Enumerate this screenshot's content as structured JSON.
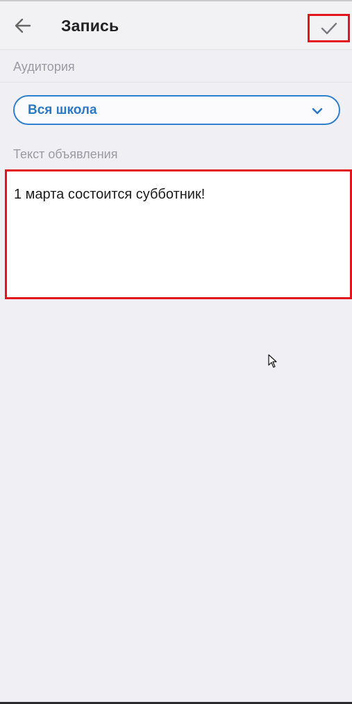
{
  "header": {
    "title": "Запись",
    "back_icon": "arrow-left-icon",
    "confirm_icon": "check-icon"
  },
  "audience": {
    "label": "Аудитория",
    "selected": "Вся школа",
    "chevron_icon": "chevron-down-icon"
  },
  "announcement": {
    "label": "Текст объявления",
    "value": "1 марта состоится субботник!"
  },
  "colors": {
    "accent": "#2f7fd0",
    "highlight": "#e3141b",
    "background": "#efeff4"
  }
}
